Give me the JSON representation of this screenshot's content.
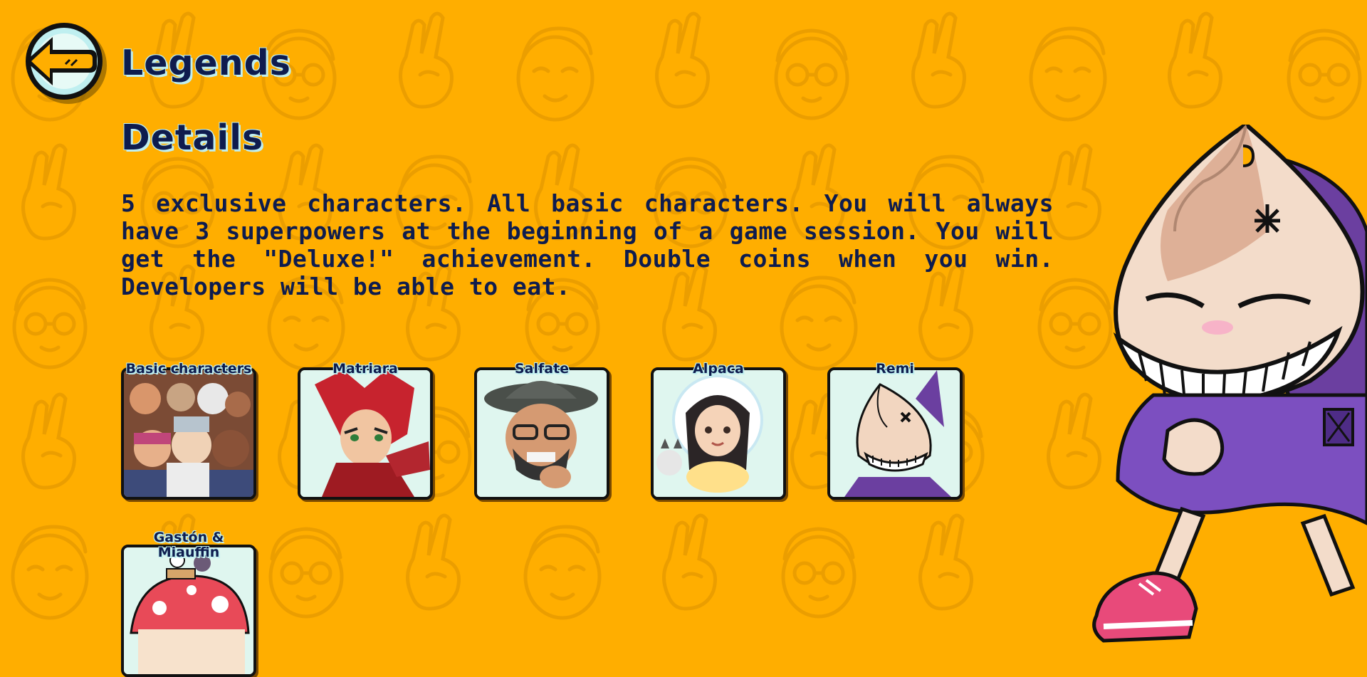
{
  "header": {
    "title": "Legends",
    "back_icon": "back-arrow-icon"
  },
  "details": {
    "title": "Details",
    "description": "5 exclusive characters. All basic characters. You will always have 3 superpowers at the beginning of a game session. You will get the \"Deluxe!\" achievement. Double coins when you win. Developers will be able to eat."
  },
  "characters": [
    {
      "label": "Basic characters"
    },
    {
      "label": "Matriara"
    },
    {
      "label": "Salfate"
    },
    {
      "label": "Alpaca"
    },
    {
      "label": "Remi"
    },
    {
      "label": "Gastón & Miauffin"
    }
  ],
  "colors": {
    "background": "#FFAE00",
    "text": "#0E1C4E",
    "outline": "#BFEFF0",
    "card_bg": "#DFF6EF"
  }
}
